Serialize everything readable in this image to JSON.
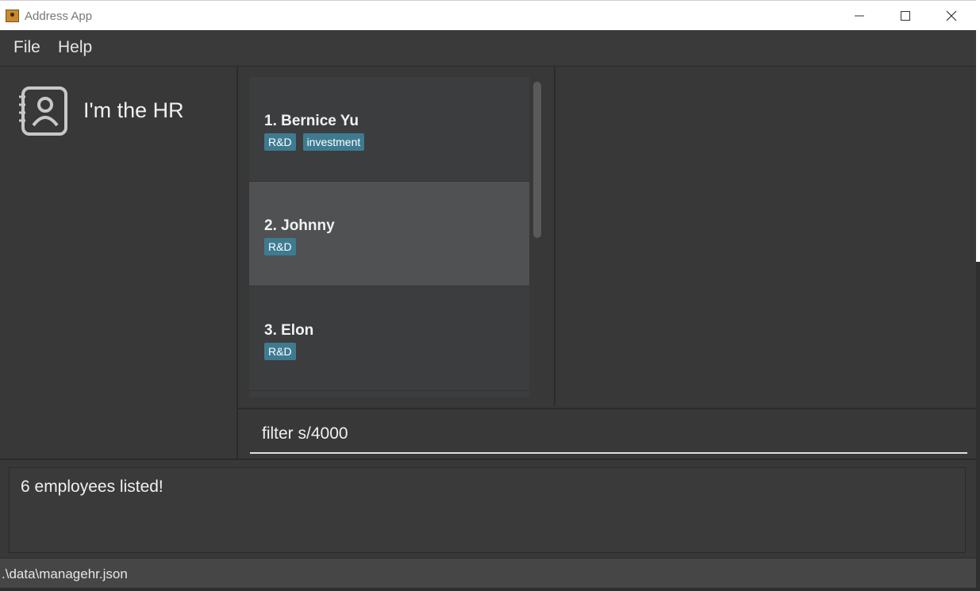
{
  "window": {
    "title": "Address App"
  },
  "menu": {
    "file": "File",
    "help": "Help"
  },
  "sidebar": {
    "title": "I'm the HR"
  },
  "employees": [
    {
      "name": "1.  Bernice Yu",
      "tags": [
        "R&D",
        "investment"
      ]
    },
    {
      "name": "2.  Johnny",
      "tags": [
        "R&D"
      ]
    },
    {
      "name": "3.  Elon",
      "tags": [
        "R&D"
      ]
    }
  ],
  "command": {
    "value": "filter s/4000"
  },
  "result": {
    "text": "6 employees listed!"
  },
  "status": {
    "path": ".\\data\\managehr.json"
  },
  "colors": {
    "tag": "#3e7b91",
    "selected_card": "#4f5153",
    "background": "#383838"
  }
}
